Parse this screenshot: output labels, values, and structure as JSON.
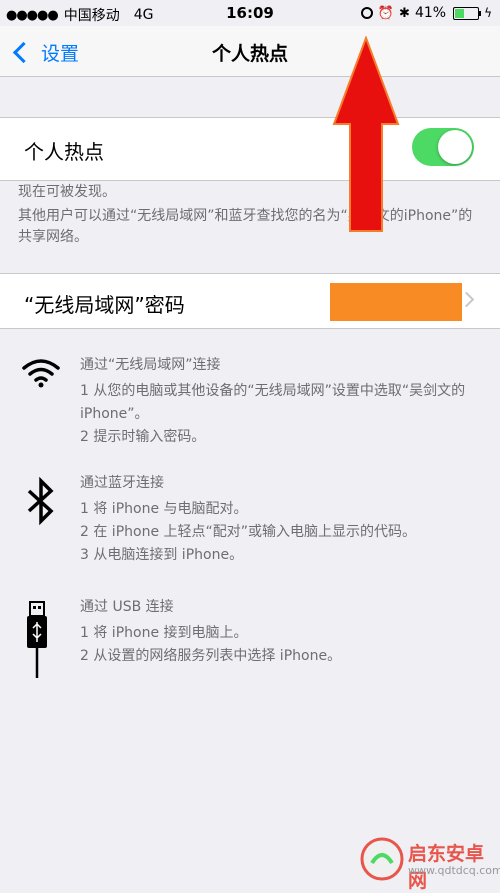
{
  "status_bar": {
    "signal": "●●●●●",
    "carrier": "中国移动",
    "network": "4G",
    "time": "16:09",
    "battery": "41%"
  },
  "nav": {
    "back_label": "设置",
    "title": "个人热点"
  },
  "hotspot": {
    "label": "个人热点",
    "toggle_on": true
  },
  "discoverable_text": "现在可被发现。",
  "share_text": "其他用户可以通过“无线局域网”和蓝牙查找您的名为“吴剑文的iPhone”的共享网络。",
  "password": {
    "label": "“无线局域网”密码"
  },
  "instructions": {
    "wifi": {
      "title": "通过“无线局域网”连接",
      "steps": [
        "1 从您的电脑或其他设备的“无线局域网”设置中选取“吴剑文的 iPhone”。",
        "2 提示时输入密码。"
      ]
    },
    "bluetooth": {
      "title": "通过蓝牙连接",
      "steps": [
        "1 将 iPhone 与电脑配对。",
        "2 在 iPhone 上轻点“配对”或输入电脑上显示的代码。",
        "3 从电脑连接到 iPhone。"
      ]
    },
    "usb": {
      "title": "通过 USB 连接",
      "steps": [
        "1 将 iPhone 接到电脑上。",
        "2 从设置的网络服务列表中选择 iPhone。"
      ]
    }
  },
  "watermark": {
    "brand": "启东安卓网",
    "url": "www.qdtdcq.com"
  },
  "colors": {
    "accent": "#007aff",
    "toggle_on": "#4cd964",
    "arrow": "#e8100f",
    "redacted": "#f98b25"
  }
}
